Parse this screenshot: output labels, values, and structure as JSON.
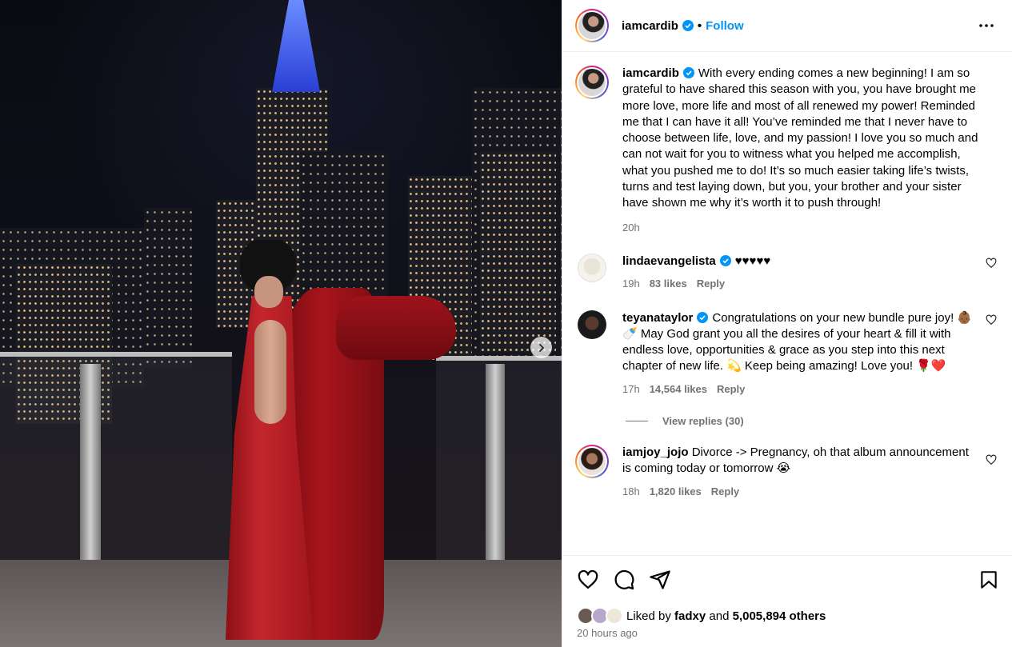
{
  "post": {
    "author": "iamcardib",
    "follow_label": "Follow",
    "caption": "With every ending comes a new beginning! I am so grateful to have shared this season with you, you have brought me more love, more life and most of all renewed my power! Reminded me that I can have it all! You’ve reminded me that I never have to choose between life, love, and my passion! I love you so much and can not wait for you to witness what you helped me accomplish, what you pushed me to do! It’s so much easier taking life’s twists, turns and test laying down, but you, your brother and your sister have shown me why it’s worth it to push through!",
    "caption_time": "20h"
  },
  "comments": [
    {
      "username": "lindaevangelista",
      "text": "♥♥♥♥♥",
      "time": "19h",
      "likes": "83 likes",
      "reply": "Reply"
    },
    {
      "username": "teyanataylor",
      "text": "Congratulations on your new bundle pure joy! 👶🏾🍼 May God grant you all the desires of your heart & fill it with endless love, opportunities & grace as you step into this next chapter of new life. 💫 Keep being amazing! Love you! 🌹❤️",
      "time": "17h",
      "likes": "14,564 likes",
      "reply": "Reply",
      "view_replies": "View replies (30)"
    },
    {
      "username": "iamjoy_jojo",
      "text": "Divorce -> Pregnancy, oh that album announcement is coming today or tomorrow 😭",
      "time": "18h",
      "likes": "1,820 likes",
      "reply": "Reply"
    }
  ],
  "footer": {
    "liked_by_prefix": "Liked by",
    "liked_by_user": "fadxy",
    "and": "and",
    "others": "5,005,894 others",
    "time_ago": "20 hours ago"
  },
  "colors": {
    "link_blue": "#0095f6",
    "verified_blue": "#0095f6",
    "muted": "#737373"
  },
  "icons": [
    "more-options-icon",
    "verified-icon",
    "heart-icon",
    "comment-icon",
    "share-icon",
    "bookmark-icon",
    "chevron-right-icon"
  ]
}
